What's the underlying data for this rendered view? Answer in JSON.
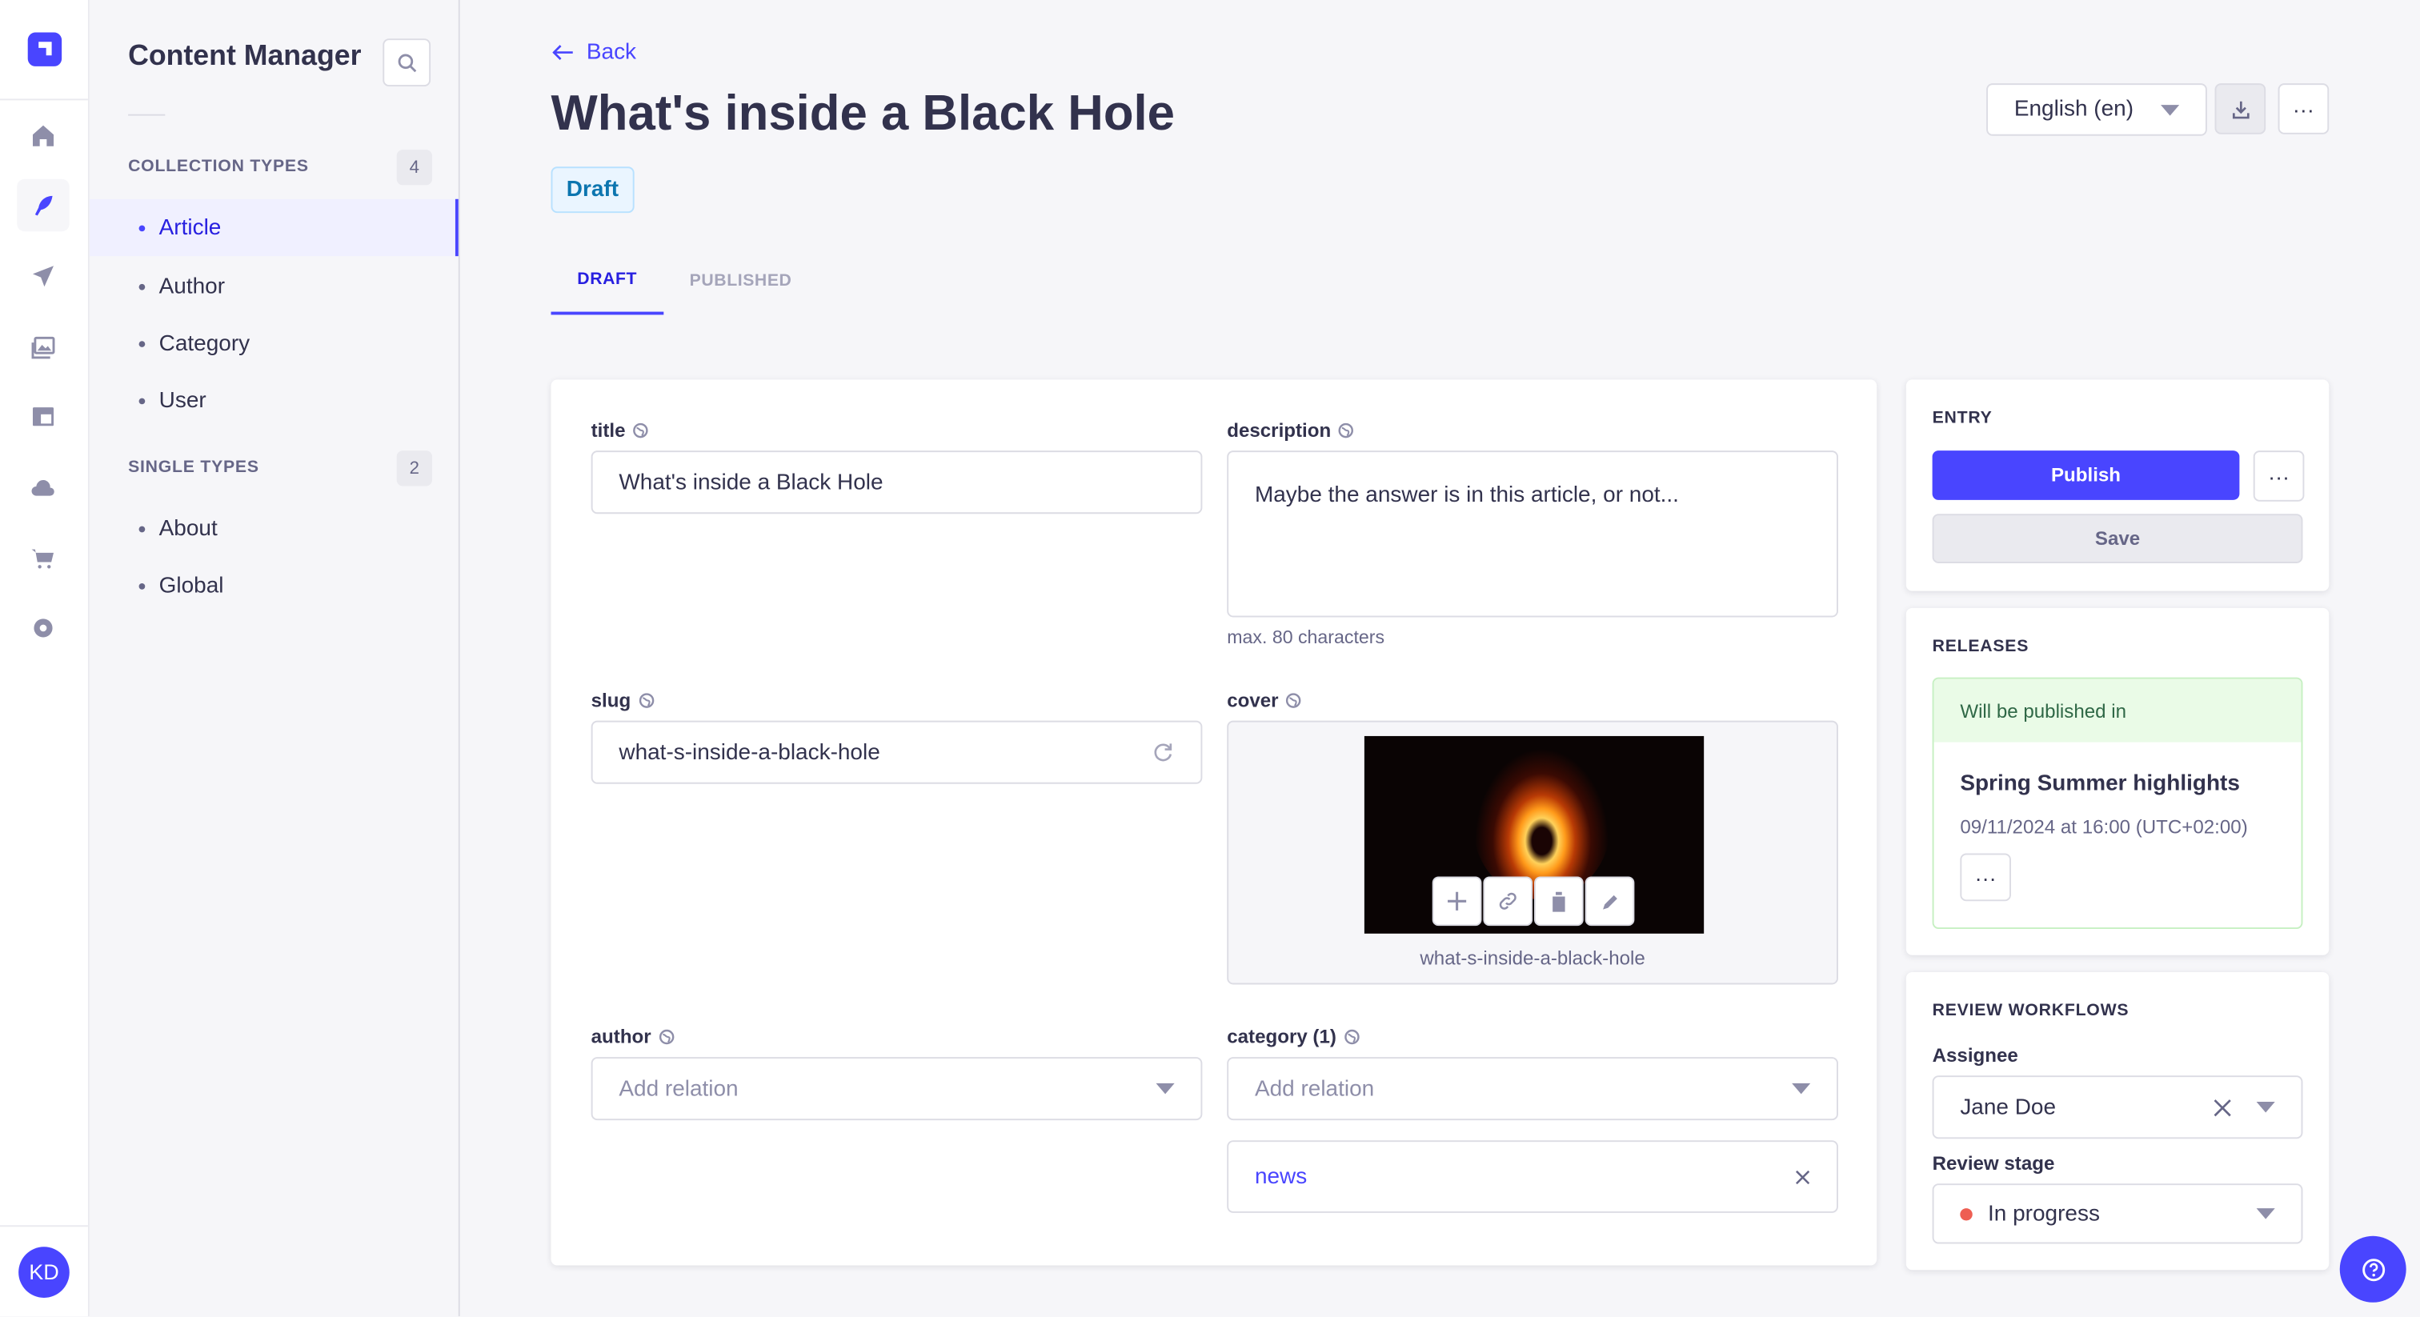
{
  "rail": {
    "items": [
      {
        "name": "home"
      },
      {
        "name": "content-manager",
        "active": true
      },
      {
        "name": "releases"
      },
      {
        "name": "media-library"
      },
      {
        "name": "content-type-builder"
      },
      {
        "name": "cloud"
      },
      {
        "name": "marketplace"
      },
      {
        "name": "settings"
      }
    ],
    "avatar_initials": "KD"
  },
  "subnav": {
    "title": "Content Manager",
    "collection_types": {
      "label": "COLLECTION TYPES",
      "count": "4",
      "items": [
        "Article",
        "Author",
        "Category",
        "User"
      ]
    },
    "single_types": {
      "label": "SINGLE TYPES",
      "count": "2",
      "items": [
        "About",
        "Global"
      ]
    }
  },
  "header": {
    "back_label": "Back",
    "title": "What's inside a Black Hole",
    "status_badge": "Draft",
    "locale": "English (en)",
    "more_label": "···"
  },
  "tabs": [
    {
      "label": "DRAFT",
      "active": true
    },
    {
      "label": "PUBLISHED",
      "active": false
    }
  ],
  "form": {
    "title": {
      "label": "title",
      "value": "What's inside a Black Hole"
    },
    "description": {
      "label": "description",
      "value": "Maybe the answer is in this article, or not...",
      "hint": "max. 80 characters"
    },
    "slug": {
      "label": "slug",
      "value": "what-s-inside-a-black-hole"
    },
    "cover": {
      "label": "cover",
      "file_name": "what-s-inside-a-black-hole"
    },
    "author": {
      "label": "author",
      "placeholder": "Add relation"
    },
    "category": {
      "label": "category (1)",
      "placeholder": "Add relation",
      "items": [
        "news"
      ]
    }
  },
  "sidebar": {
    "entry": {
      "heading": "ENTRY",
      "publish": "Publish",
      "save": "Save",
      "more": "···"
    },
    "releases": {
      "heading": "RELEASES",
      "banner": "Will be published in",
      "release_name": "Spring Summer highlights",
      "release_date": "09/11/2024 at 16:00 (UTC+02:00)",
      "more": "···"
    },
    "review": {
      "heading": "REVIEW WORKFLOWS",
      "assignee_label": "Assignee",
      "assignee": "Jane Doe",
      "stage_label": "Review stage",
      "stage": "In progress",
      "stage_color": "#ee5e52"
    }
  },
  "colors": {
    "primary": "#4945ff",
    "text": "#32324d",
    "muted": "#666687"
  }
}
